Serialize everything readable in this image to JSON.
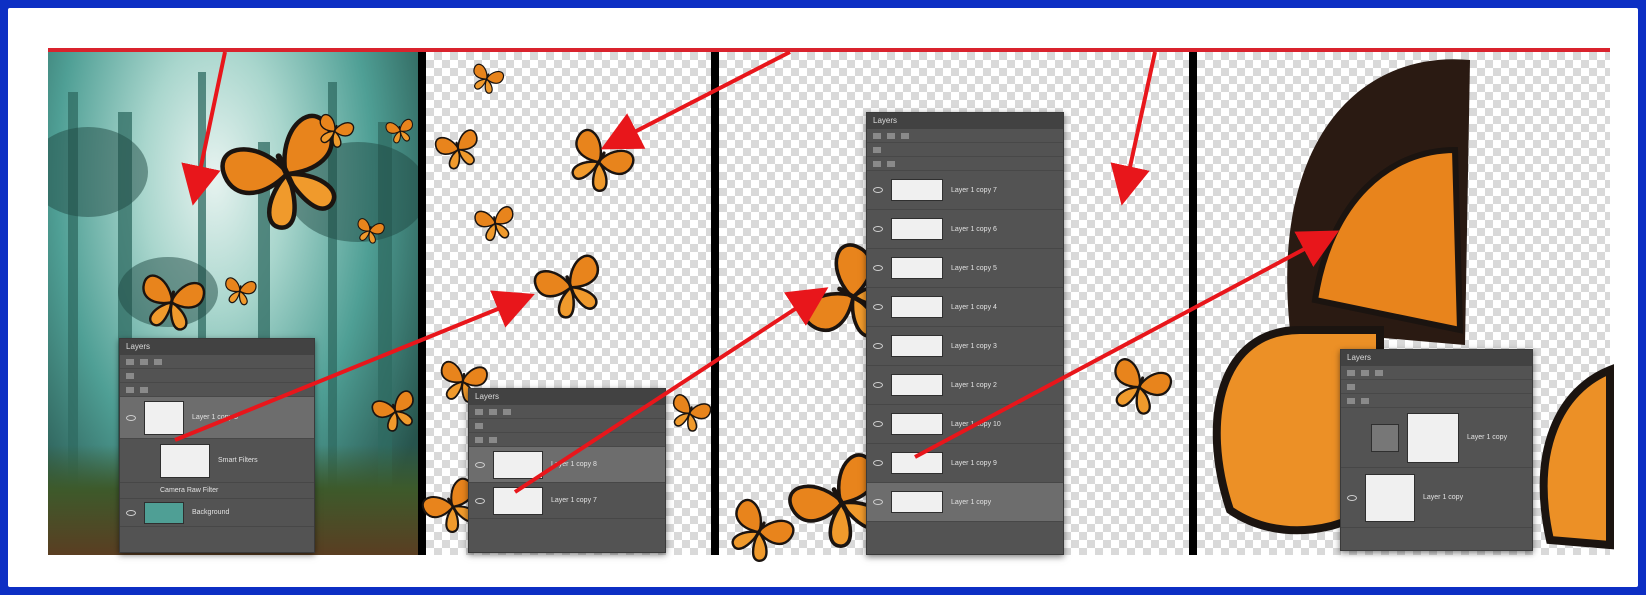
{
  "colors": {
    "background": "#0d2fc4",
    "frame": "#ffffff",
    "accent_line": "#d9232d",
    "arrow": "#e8161b",
    "ps_panel": "#535353"
  },
  "panels": [
    {
      "name": "forest-composite"
    },
    {
      "name": "butterflies-transparent"
    },
    {
      "name": "butterfly-layers-list"
    },
    {
      "name": "butterfly-closeup"
    }
  ],
  "layers_panel_1": {
    "title": "Layers",
    "layers": [
      {
        "name": "Layer 1 copy 8",
        "selected": true
      },
      {
        "name": "Smart Filters",
        "selected": false
      },
      {
        "name": "Camera Raw Filter",
        "selected": false
      },
      {
        "name": "Background",
        "selected": false
      }
    ]
  },
  "layers_panel_2": {
    "title": "Layers",
    "layers": [
      {
        "name": "Layer 1 copy 8",
        "selected": true
      },
      {
        "name": "Layer 1 copy 7",
        "selected": false
      }
    ]
  },
  "layers_panel_3": {
    "title": "Layers",
    "layers": [
      {
        "name": "Layer 1 copy 7",
        "selected": false
      },
      {
        "name": "Layer 1 copy 6",
        "selected": false
      },
      {
        "name": "Layer 1 copy 5",
        "selected": false
      },
      {
        "name": "Layer 1 copy 4",
        "selected": false
      },
      {
        "name": "Layer 1 copy 3",
        "selected": false
      },
      {
        "name": "Layer 1 copy 2",
        "selected": false
      },
      {
        "name": "Layer 1 copy 10",
        "selected": false
      },
      {
        "name": "Layer 1 copy 9",
        "selected": false
      },
      {
        "name": "Layer 1 copy",
        "selected": true
      }
    ]
  },
  "layers_panel_4": {
    "title": "Layers",
    "layers": [
      {
        "name": "Layer 1 copy",
        "selected": false
      },
      {
        "name": "Layer 1 copy",
        "selected": false
      }
    ]
  }
}
